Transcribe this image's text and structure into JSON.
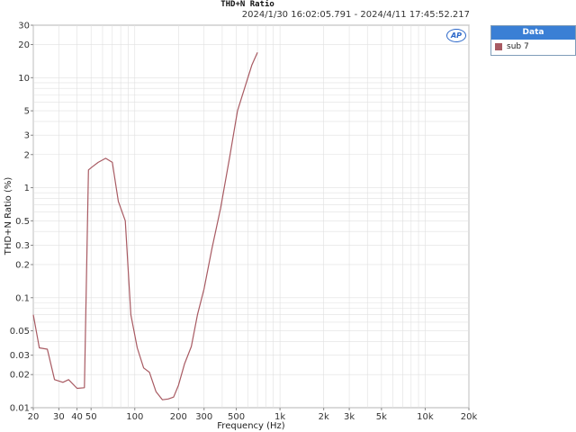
{
  "colors": {
    "series": "#a85a62",
    "grid": "#e0e0e0",
    "axis": "#888888",
    "legend_header": "#3a7fd5"
  },
  "legend": {
    "title": "Data"
  },
  "logo_text": "AP",
  "chart_data": {
    "type": "line",
    "title": "THD+N Ratio",
    "subtitle": "2024/1/30 16:02:05.791 - 2024/4/11 17:45:52.217",
    "xlabel": "Frequency (Hz)",
    "ylabel": "THD+N Ratio (%)",
    "x_scale": "log",
    "y_scale": "log",
    "xlim": [
      20,
      20000
    ],
    "ylim": [
      0.01,
      30
    ],
    "grid": true,
    "legend_position": "right",
    "x_ticks": [
      {
        "v": 20,
        "label": "20"
      },
      {
        "v": 30,
        "label": "30"
      },
      {
        "v": 40,
        "label": "40"
      },
      {
        "v": 50,
        "label": "50"
      },
      {
        "v": 100,
        "label": "100"
      },
      {
        "v": 200,
        "label": "200"
      },
      {
        "v": 300,
        "label": "300"
      },
      {
        "v": 500,
        "label": "500"
      },
      {
        "v": 1000,
        "label": "1k"
      },
      {
        "v": 2000,
        "label": "2k"
      },
      {
        "v": 3000,
        "label": "3k"
      },
      {
        "v": 5000,
        "label": "5k"
      },
      {
        "v": 10000,
        "label": "10k"
      },
      {
        "v": 20000,
        "label": "20k"
      }
    ],
    "y_ticks": [
      {
        "v": 30,
        "label": "30"
      },
      {
        "v": 20,
        "label": "20"
      },
      {
        "v": 10,
        "label": "10"
      },
      {
        "v": 5,
        "label": "5"
      },
      {
        "v": 3,
        "label": "3"
      },
      {
        "v": 2,
        "label": "2"
      },
      {
        "v": 1,
        "label": "1"
      },
      {
        "v": 0.5,
        "label": "0.5"
      },
      {
        "v": 0.3,
        "label": "0.3"
      },
      {
        "v": 0.2,
        "label": "0.2"
      },
      {
        "v": 0.1,
        "label": "0.1"
      },
      {
        "v": 0.05,
        "label": "0.05"
      },
      {
        "v": 0.03,
        "label": "0.03"
      },
      {
        "v": 0.02,
        "label": "0.02"
      },
      {
        "v": 0.01,
        "label": "0.01"
      }
    ],
    "series": [
      {
        "name": "sub 7",
        "color": "#a85a62",
        "x": [
          20,
          22,
          25,
          28,
          32,
          35,
          40,
          45,
          48,
          51,
          56,
          63,
          70,
          77,
          86,
          94,
          104,
          115,
          126,
          140,
          155,
          170,
          185,
          200,
          220,
          245,
          270,
          300,
          340,
          390,
          450,
          510,
          570,
          640,
          700
        ],
        "y": [
          0.07,
          0.035,
          0.034,
          0.018,
          0.017,
          0.018,
          0.015,
          0.0152,
          1.45,
          1.55,
          1.7,
          1.85,
          1.7,
          0.75,
          0.5,
          0.07,
          0.035,
          0.023,
          0.021,
          0.014,
          0.0118,
          0.012,
          0.0125,
          0.016,
          0.025,
          0.036,
          0.07,
          0.12,
          0.28,
          0.65,
          1.9,
          5.0,
          8.0,
          13.0,
          17.0
        ]
      }
    ]
  }
}
